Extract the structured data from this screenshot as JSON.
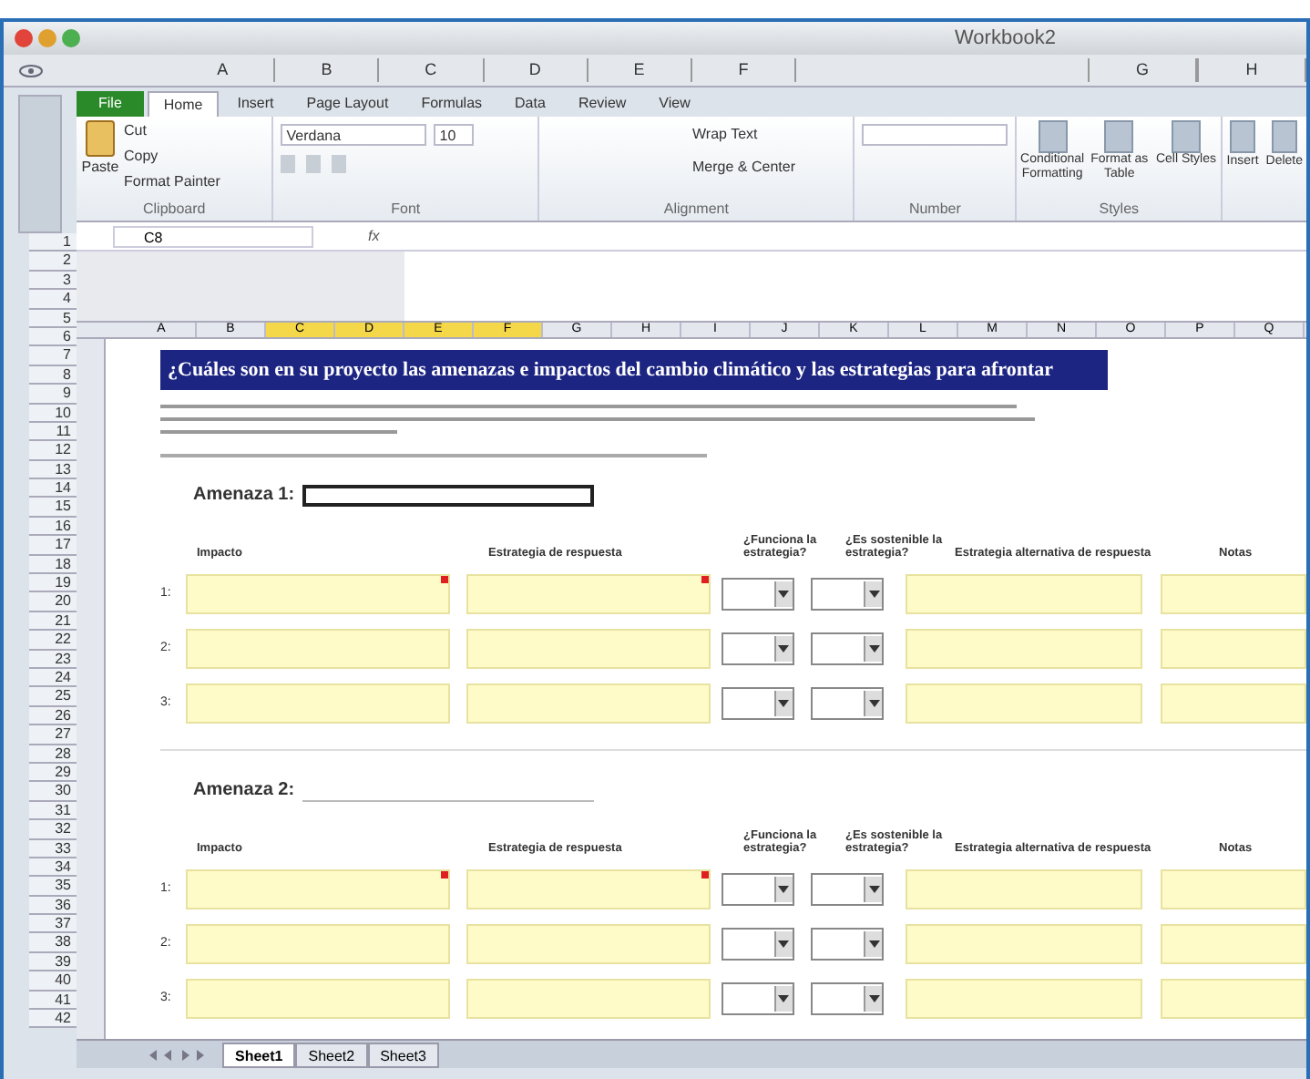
{
  "window": {
    "title": "Workbook2"
  },
  "ruler": {
    "columns": [
      "A",
      "B",
      "C",
      "D",
      "E",
      "F"
    ],
    "columns_right": [
      "G",
      "H"
    ]
  },
  "ribbon": {
    "tabs": [
      {
        "label": "File",
        "selected": false,
        "kind": "file"
      },
      {
        "label": "Home",
        "selected": true,
        "kind": "tab"
      },
      {
        "label": "Insert",
        "selected": false,
        "kind": "tab"
      },
      {
        "label": "Page Layout",
        "selected": false,
        "kind": "tab"
      },
      {
        "label": "Formulas",
        "selected": false,
        "kind": "tab"
      },
      {
        "label": "Data",
        "selected": false,
        "kind": "tab"
      },
      {
        "label": "Review",
        "selected": false,
        "kind": "tab"
      },
      {
        "label": "View",
        "selected": false,
        "kind": "tab"
      }
    ],
    "clipboard": {
      "paste": "Paste",
      "items": [
        "Cut",
        "Copy",
        "Format Painter"
      ],
      "label": "Clipboard"
    },
    "font": {
      "name": "Verdana",
      "size": "10",
      "label": "Font"
    },
    "alignment": {
      "wrap": "Wrap Text",
      "merge": "Merge & Center",
      "label": "Alignment"
    },
    "number": {
      "label": "Number"
    },
    "styles": {
      "items": [
        "Conditional Formatting",
        "Format as Table",
        "Cell Styles"
      ],
      "label": "Styles"
    },
    "cells": {
      "items": [
        "Insert",
        "Delete"
      ]
    }
  },
  "formula_bar": {
    "name_box": "C8",
    "fx": "fx"
  },
  "outer_rows": [
    "1",
    "2",
    "3",
    "4",
    "5",
    "6",
    "7",
    "8",
    "9",
    "10",
    "11",
    "12",
    "13",
    "14",
    "15",
    "16",
    "17",
    "18",
    "19",
    "20",
    "21",
    "22",
    "23",
    "24",
    "25",
    "26",
    "27",
    "28",
    "29",
    "30",
    "31",
    "32",
    "33",
    "34",
    "35",
    "36",
    "37",
    "38",
    "39",
    "40",
    "41",
    "42"
  ],
  "sheet": {
    "columns": [
      {
        "label": "A",
        "selected": false
      },
      {
        "label": "B",
        "selected": false
      },
      {
        "label": "C",
        "selected": true
      },
      {
        "label": "D",
        "selected": true
      },
      {
        "label": "E",
        "selected": true
      },
      {
        "label": "F",
        "selected": true
      },
      {
        "label": "G",
        "selected": false
      },
      {
        "label": "H",
        "selected": false
      },
      {
        "label": "I",
        "selected": false
      },
      {
        "label": "J",
        "selected": false
      },
      {
        "label": "K",
        "selected": false
      },
      {
        "label": "L",
        "selected": false
      },
      {
        "label": "M",
        "selected": false
      },
      {
        "label": "N",
        "selected": false
      },
      {
        "label": "O",
        "selected": false
      },
      {
        "label": "P",
        "selected": false
      },
      {
        "label": "Q",
        "selected": false
      }
    ],
    "banner": "¿Cuáles son en su proyecto las amenazas e impactos del cambio climático y las estrategias para afrontar",
    "sections": [
      {
        "label": "Amenaza 1:",
        "headers": [
          "Impacto",
          "Estrategia de respuesta",
          "¿Funciona la estrategia?",
          "¿Es sostenible la estrategia?",
          "Estrategia alternativa de respuesta",
          "Notas"
        ],
        "rows": [
          {
            "number": "1:",
            "comment": true
          },
          {
            "number": "2:",
            "comment": false
          },
          {
            "number": "3:",
            "comment": false
          }
        ]
      },
      {
        "label": "Amenaza 2:",
        "headers": [
          "Impacto",
          "Estrategia de respuesta",
          "¿Funciona la estrategia?",
          "¿Es sostenible la estrategia?",
          "Estrategia alternativa de respuesta",
          "Notas"
        ],
        "rows": [
          {
            "number": "1:",
            "comment": true
          },
          {
            "number": "2:",
            "comment": false
          },
          {
            "number": "3:",
            "comment": false
          }
        ]
      }
    ]
  },
  "sheet_tabs": [
    {
      "label": "Sheet1",
      "selected": true
    },
    {
      "label": "Sheet2",
      "selected": false
    },
    {
      "label": "Sheet3",
      "selected": false
    }
  ]
}
